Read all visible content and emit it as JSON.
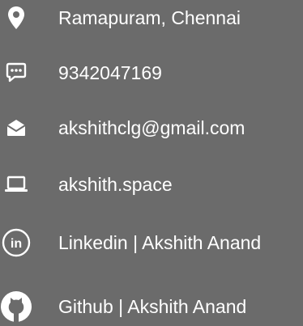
{
  "contacts": {
    "location": {
      "text": "Ramapuram, Chennai",
      "icon": "location-pin-icon"
    },
    "phone": {
      "text": "9342047169",
      "icon": "chat-bubble-icon"
    },
    "email": {
      "text": "akshithclg@gmail.com",
      "icon": "envelope-icon"
    },
    "website": {
      "text": "akshith.space",
      "icon": "laptop-icon"
    },
    "linkedin": {
      "text": "Linkedin | Akshith Anand",
      "icon": "linkedin-icon",
      "icon_text": "in"
    },
    "github": {
      "text": "Github | Akshith Anand",
      "icon": "github-icon"
    }
  },
  "colors": {
    "background": "#6b6b6b",
    "foreground": "#ffffff"
  }
}
